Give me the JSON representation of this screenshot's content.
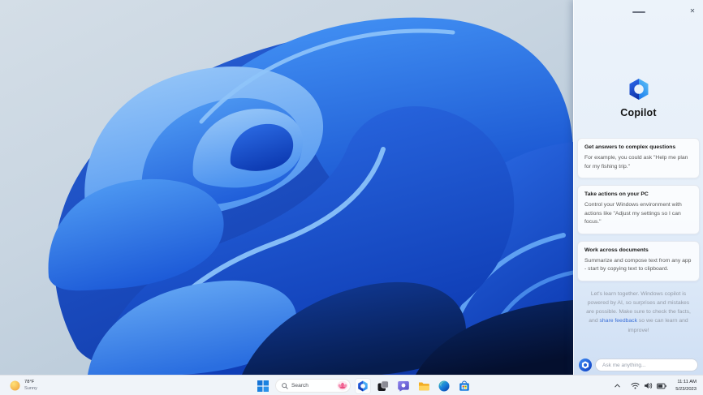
{
  "panel": {
    "window": {
      "handle_icon": "drag-handle-icon",
      "close_glyph": "✕"
    },
    "logo_icon": "copilot-logo-icon",
    "title": "Copilot",
    "cards": [
      {
        "title": "Get answers to complex questions",
        "body": "For example, you could ask \"Help me plan for my fishing trip.\""
      },
      {
        "title": "Take actions on your PC",
        "body": "Control your Windows environment with actions like \"Adjust my settings so I can focus.\""
      },
      {
        "title": "Work across documents",
        "body": "Summarize and compose text from any app - start by copying text to clipboard."
      }
    ],
    "disclaimer": {
      "pre": "Let's learn together. Windows copilot is powered by AI, so surprises and mistakes are possible. Make sure to check the facts, and ",
      "link": "share feedback",
      "post": " so we can learn and improve!"
    },
    "input": {
      "icon": "copilot-badge-icon",
      "placeholder": "Ask me anything..."
    }
  },
  "taskbar": {
    "weather": {
      "icon": "sun-icon",
      "temp": "78°F",
      "condition": "Sunny"
    },
    "start_icon": "start-icon",
    "search": {
      "icon": "search-icon",
      "label": "Search",
      "highlight_icon": "search-highlight-flower-icon"
    },
    "app_icons": [
      "copilot-icon",
      "task-view-icon",
      "chat-icon",
      "file-explorer-icon",
      "edge-icon",
      "store-icon"
    ],
    "active_app": "copilot-icon",
    "tray": {
      "icons": [
        "chevron-up-icon",
        "wifi-icon",
        "speaker-icon",
        "battery-icon"
      ],
      "time": "11:11 AM",
      "date": "5/23/2023"
    }
  },
  "colors": {
    "accent_blue": "#0b62d6",
    "link_blue": "#3a6fd8",
    "panel_bg": "#e9f1fa",
    "taskbar_bg": "#f2f5fa",
    "copilot_gradient_light": "#56b6f6",
    "copilot_gradient_dark": "#1742d6",
    "wallpaper_deep_navy": "#06123a",
    "wallpaper_bright_blue": "#2e82f0"
  }
}
